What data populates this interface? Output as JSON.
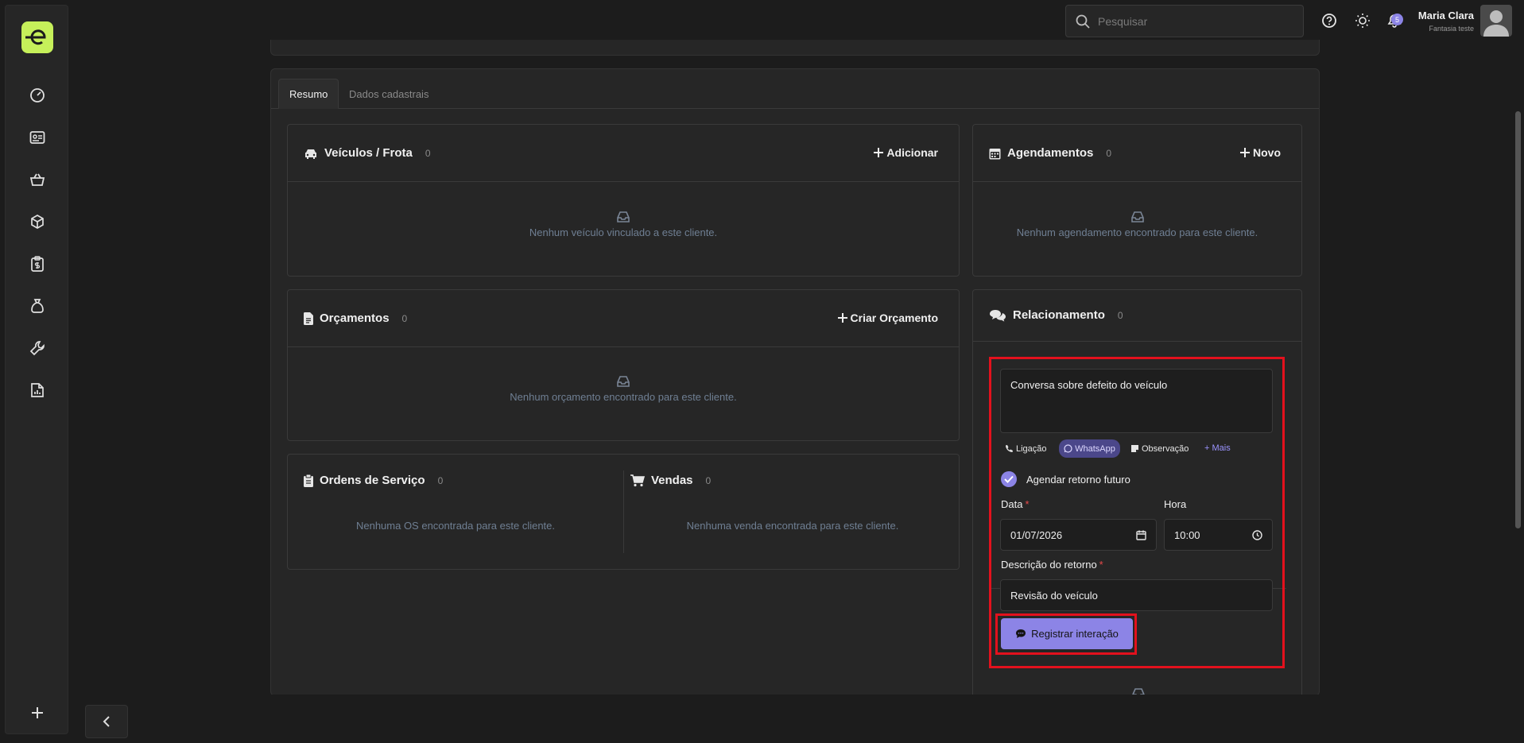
{
  "search": {
    "placeholder": "Pesquisar"
  },
  "header": {
    "notification_count": "5",
    "user_name": "Maria Clara",
    "user_company": "Fantasia teste"
  },
  "tabs": [
    {
      "label": "Resumo"
    },
    {
      "label": "Dados cadastrais"
    }
  ],
  "vehicles": {
    "title": "Veículos / Frota",
    "count": "0",
    "action": "Adicionar",
    "empty": "Nenhum veículo vinculado a este cliente."
  },
  "appointments": {
    "title": "Agendamentos",
    "count": "0",
    "action": "Novo",
    "empty": "Nenhum agendamento encontrado para este cliente."
  },
  "quotes": {
    "title": "Orçamentos",
    "count": "0",
    "action": "Criar Orçamento",
    "empty": "Nenhum orçamento encontrado para este cliente."
  },
  "service_orders": {
    "title": "Ordens de Serviço",
    "count": "0",
    "empty": "Nenhuma OS encontrada para este cliente."
  },
  "sales": {
    "title": "Vendas",
    "count": "0",
    "empty": "Nenhuma venda encontrada para este cliente."
  },
  "relationship": {
    "title": "Relacionamento",
    "count": "0",
    "note": "Conversa sobre defeito do veículo",
    "types": {
      "call": "Ligação",
      "whatsapp": "WhatsApp",
      "note": "Observação",
      "more": "+ Mais"
    },
    "schedule_label": "Agendar retorno futuro",
    "schedule_checked": true,
    "date_label": "Data",
    "date_value": "01/07/2026",
    "time_label": "Hora",
    "time_value": "10:00",
    "desc_label": "Descrição do retorno",
    "desc_value": "Revisão do veículo",
    "submit": "Registrar interação"
  },
  "colors": {
    "accent": "#8c84e6",
    "brand": "#c6f05a",
    "highlight": "#e3111d"
  }
}
